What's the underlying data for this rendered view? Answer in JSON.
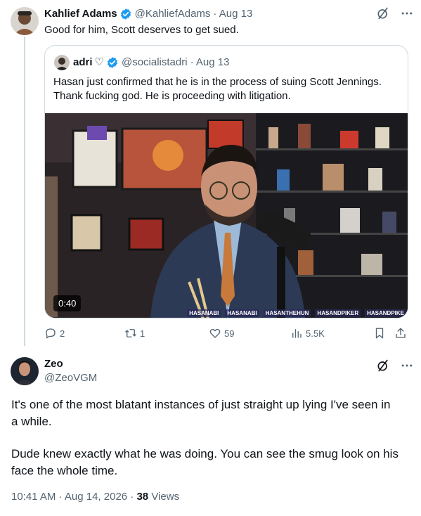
{
  "post1": {
    "author_name": "Kahlief Adams",
    "handle": "@KahliefAdams",
    "date": "· Aug 13",
    "text": "Good for him, Scott deserves to get sued.",
    "quote": {
      "author_name": "adri",
      "heart": "♡",
      "handle": "@socialistadri",
      "date": "· Aug 13",
      "text_line1": "Hasan just confirmed that he is in the process of suing Scott Jennings.",
      "text_line2": "Thank fucking god. He is proceeding with litigation.",
      "video_duration": "0:40",
      "ticker": [
        "HASANABI",
        "HASANABI",
        "HASANTHEHUN",
        "HASANDPIKER",
        "HASANDPIKE"
      ]
    },
    "actions": {
      "replies": "2",
      "reposts": "1",
      "likes": "59",
      "views": "5.5K"
    }
  },
  "post2": {
    "author_name": "Zeo",
    "handle": "@ZeoVGM",
    "paragraph1_line1": "It's one of the most blatant instances of just straight up lying I've seen in",
    "paragraph1_line2": "a while.",
    "paragraph2_line1": "Dude knew exactly what he was doing. You can see the smug look on his",
    "paragraph2_line2": "face the whole time.",
    "time": "10:41 AM · Aug 14, 2026 ·",
    "views_count": "38",
    "views_label": "Views"
  },
  "icons": {
    "verified": "verified-badge-icon",
    "grok": "grok-icon",
    "more": "more-icon",
    "reply": "reply-icon",
    "repost": "repost-icon",
    "like": "like-icon",
    "views": "views-icon",
    "bookmark": "bookmark-icon",
    "share": "share-icon"
  },
  "colors": {
    "accent": "#1d9bf0",
    "text": "#0f1419",
    "muted": "#536471",
    "border": "#cfd9de"
  }
}
